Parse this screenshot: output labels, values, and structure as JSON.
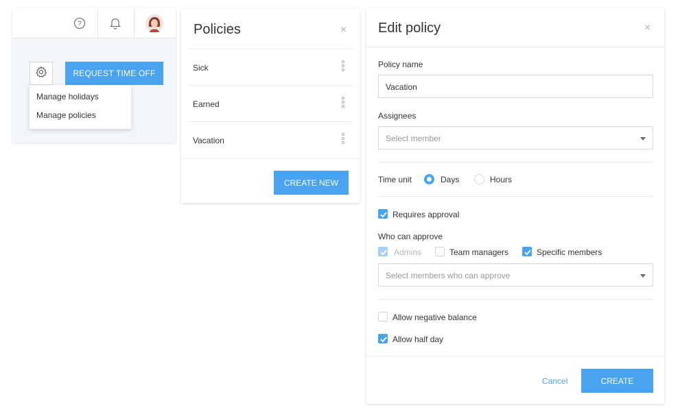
{
  "colors": {
    "accent": "#4aa3ee",
    "border": "#cfd6dc",
    "muted": "#aab3ba"
  },
  "topbar": {
    "help_icon": "question-circle-icon",
    "bell_icon": "bell-icon",
    "avatar": "user-avatar"
  },
  "toolbar": {
    "settings_icon": "gear-icon",
    "request_button": "REQUEST TIME OFF"
  },
  "settings_menu": {
    "items": [
      "Manage holidays",
      "Manage policies"
    ]
  },
  "policies_panel": {
    "title": "Policies",
    "close": "×",
    "items": [
      {
        "label": "Sick"
      },
      {
        "label": "Earned"
      },
      {
        "label": "Vacation"
      }
    ],
    "create_button": "CREATE NEW"
  },
  "edit_policy": {
    "title": "Edit policy",
    "close": "×",
    "policy_name_label": "Policy name",
    "policy_name_value": "Vacation",
    "assignees_label": "Assignees",
    "assignees_placeholder": "Select member",
    "time_unit_label": "Time unit",
    "time_unit_options": [
      "Days",
      "Hours"
    ],
    "time_unit_selected": "Days",
    "requires_approval_label": "Requires approval",
    "requires_approval": true,
    "who_can_approve_label": "Who can approve",
    "approvers": [
      {
        "label": "Admins",
        "checked": true,
        "disabled": true
      },
      {
        "label": "Team managers",
        "checked": false,
        "disabled": false
      },
      {
        "label": "Specific members",
        "checked": true,
        "disabled": false
      }
    ],
    "approvers_placeholder": "Select members who can approve",
    "allow_negative_label": "Allow negative balance",
    "allow_negative": false,
    "allow_half_day_label": "Allow half day",
    "allow_half_day": true,
    "cancel_button": "Cancel",
    "create_button": "CREATE"
  }
}
